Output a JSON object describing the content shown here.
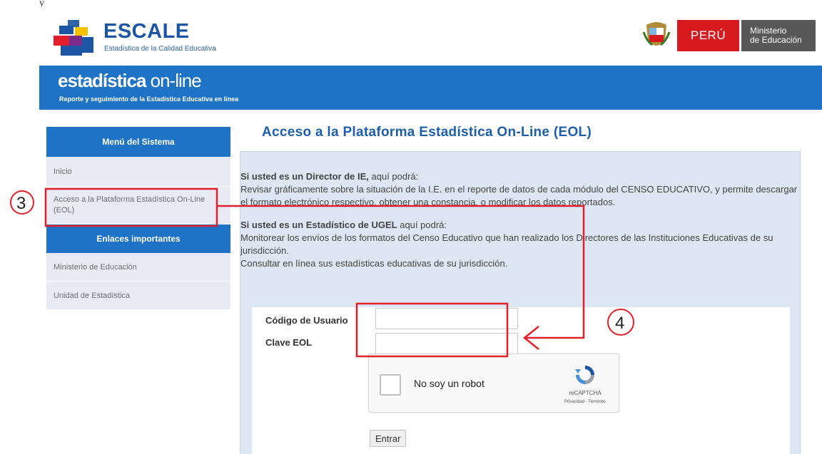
{
  "top_fragment": "y",
  "header": {
    "logo_title": "ESCALE",
    "logo_subtitle": "Estadística de la Calidad Educativa",
    "gov_country": "PERÚ",
    "gov_ministry_line1": "Ministerio",
    "gov_ministry_line2": "de Educación"
  },
  "banner": {
    "title_main": "estadística",
    "title_suffix": "on-line",
    "subtitle": "Reporte y seguimiento de la Estadística Educativa en línea"
  },
  "sidebar": {
    "menu_heading": "Menú del Sistema",
    "menu_items": [
      {
        "label": "Inicio"
      },
      {
        "label": "Acceso a la Plataforma Estadística On-Line (EOL)"
      }
    ],
    "links_heading": "Enlaces importantes",
    "link_items": [
      {
        "label": "Ministerio de Educación"
      },
      {
        "label": "Unidad de Estadística"
      }
    ]
  },
  "main": {
    "title": "Acceso a la Plataforma Estadística On-Line (EOL)",
    "director_lead": "Si usted es un Director de IE,",
    "director_rest": " aquí podrá:",
    "director_text": "Revisar gráficamente sobre la situación de la I.E. en el reporte de datos de cada módulo del CENSO EDUCATIVO, y permite descargar el formato electrónico respectivo, obtener una constancia, o modificar los datos reportados.",
    "ugel_lead": "Si usted es un Estadístico de UGEL",
    "ugel_rest": " aquí podrá:",
    "ugel_text_1": "Monitorear los envíos de los formatos del Censo Educativo que han realizado los Directores de las Instituciones Educativas de su jurisdicción.",
    "ugel_text_2": "Consultar en línea sus estadísticas educativas de su jurisdicción."
  },
  "form": {
    "user_label": "Código de Usuario",
    "user_value": "",
    "password_label": "Clave EOL",
    "password_value": "",
    "captcha_label": "No soy un robot",
    "captcha_brand": "reCAPTCHA",
    "captcha_links": "Privacidad - Términos",
    "submit_label": "Entrar"
  },
  "annotations": {
    "step_3": "3",
    "step_4": "4",
    "color": "#e0202a"
  }
}
